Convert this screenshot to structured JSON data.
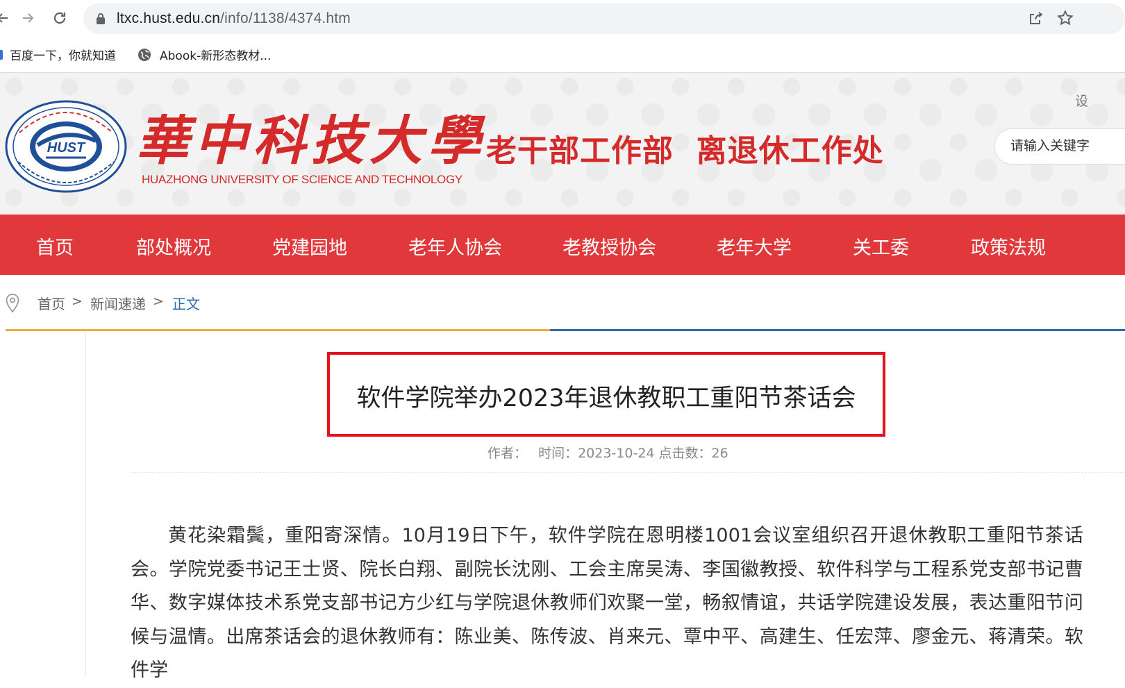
{
  "browser": {
    "url_host": "ltxc.hust.edu.cn",
    "url_path": "/info/1138/4374.htm",
    "bookmarks": [
      {
        "label": "百度一下，你就知道"
      },
      {
        "label": "Abook-新形态教材..."
      }
    ]
  },
  "header": {
    "university_name": "華中科技大學",
    "university_name_en": "HUAZHONG UNIVERSITY OF SCIENCE AND TECHNOLOGY",
    "emblem_text": "HUST",
    "department": "老干部工作部  离退休工作处",
    "settings_link": "设",
    "search_placeholder": "请输入关键字"
  },
  "nav": {
    "items": [
      {
        "label": "首页"
      },
      {
        "label": "部处概况"
      },
      {
        "label": "党建园地"
      },
      {
        "label": "老年人协会"
      },
      {
        "label": "老教授协会"
      },
      {
        "label": "老年大学"
      },
      {
        "label": "关工委"
      },
      {
        "label": "政策法规"
      }
    ]
  },
  "breadcrumb": {
    "items": [
      {
        "label": "首页"
      },
      {
        "label": "新闻速递"
      },
      {
        "label": "正文"
      }
    ],
    "separator": ">"
  },
  "article": {
    "title": "软件学院举办2023年退休教职工重阳节茶话会",
    "author_label": "作者：",
    "time_label": "时间：",
    "date": "2023-10-24",
    "hits_label": "点击数：",
    "hits": "26",
    "body": "黄花染霜鬓，重阳寄深情。10月19日下午，软件学院在恩明楼1001会议室组织召开退休教职工重阳节茶话会。学院党委书记王士贤、院长白翔、副院长沈刚、工会主席吴涛、李国徽教授、软件科学与工程系党支部书记曹华、数字媒体技术系党支部书记方少红与学院退休教师们欢聚一堂，畅叙情谊，共话学院建设发展，表达重阳节问候与温情。出席茶话会的退休教师有：陈业美、陈传波、肖来元、覃中平、高建生、任宏萍、廖金元、蒋清荣。软件学"
  },
  "colors": {
    "brand_red": "#e0383b",
    "title_highlight": "#e3121d",
    "accent_orange": "#f2a93b",
    "accent_blue": "#2f6bb1",
    "link_blue": "#2b6cb0"
  }
}
